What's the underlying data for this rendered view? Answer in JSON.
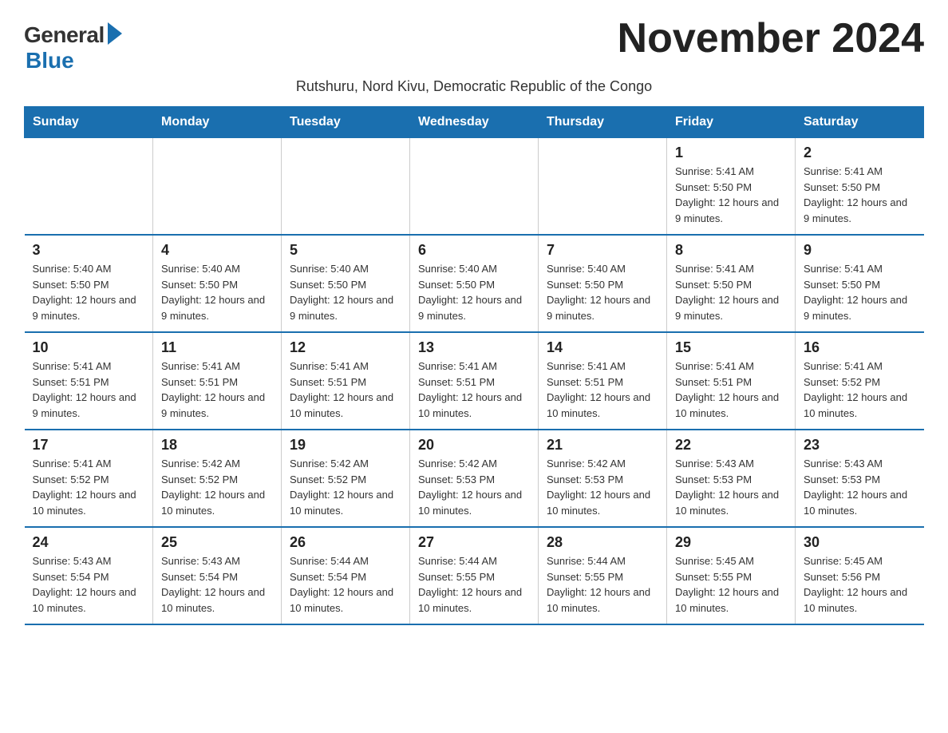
{
  "logo": {
    "general": "General",
    "blue": "Blue"
  },
  "title": "November 2024",
  "subtitle": "Rutshuru, Nord Kivu, Democratic Republic of the Congo",
  "days_of_week": [
    "Sunday",
    "Monday",
    "Tuesday",
    "Wednesday",
    "Thursday",
    "Friday",
    "Saturday"
  ],
  "weeks": [
    [
      {
        "day": "",
        "info": ""
      },
      {
        "day": "",
        "info": ""
      },
      {
        "day": "",
        "info": ""
      },
      {
        "day": "",
        "info": ""
      },
      {
        "day": "",
        "info": ""
      },
      {
        "day": "1",
        "info": "Sunrise: 5:41 AM\nSunset: 5:50 PM\nDaylight: 12 hours\nand 9 minutes."
      },
      {
        "day": "2",
        "info": "Sunrise: 5:41 AM\nSunset: 5:50 PM\nDaylight: 12 hours\nand 9 minutes."
      }
    ],
    [
      {
        "day": "3",
        "info": "Sunrise: 5:40 AM\nSunset: 5:50 PM\nDaylight: 12 hours\nand 9 minutes."
      },
      {
        "day": "4",
        "info": "Sunrise: 5:40 AM\nSunset: 5:50 PM\nDaylight: 12 hours\nand 9 minutes."
      },
      {
        "day": "5",
        "info": "Sunrise: 5:40 AM\nSunset: 5:50 PM\nDaylight: 12 hours\nand 9 minutes."
      },
      {
        "day": "6",
        "info": "Sunrise: 5:40 AM\nSunset: 5:50 PM\nDaylight: 12 hours\nand 9 minutes."
      },
      {
        "day": "7",
        "info": "Sunrise: 5:40 AM\nSunset: 5:50 PM\nDaylight: 12 hours\nand 9 minutes."
      },
      {
        "day": "8",
        "info": "Sunrise: 5:41 AM\nSunset: 5:50 PM\nDaylight: 12 hours\nand 9 minutes."
      },
      {
        "day": "9",
        "info": "Sunrise: 5:41 AM\nSunset: 5:50 PM\nDaylight: 12 hours\nand 9 minutes."
      }
    ],
    [
      {
        "day": "10",
        "info": "Sunrise: 5:41 AM\nSunset: 5:51 PM\nDaylight: 12 hours\nand 9 minutes."
      },
      {
        "day": "11",
        "info": "Sunrise: 5:41 AM\nSunset: 5:51 PM\nDaylight: 12 hours\nand 9 minutes."
      },
      {
        "day": "12",
        "info": "Sunrise: 5:41 AM\nSunset: 5:51 PM\nDaylight: 12 hours\nand 10 minutes."
      },
      {
        "day": "13",
        "info": "Sunrise: 5:41 AM\nSunset: 5:51 PM\nDaylight: 12 hours\nand 10 minutes."
      },
      {
        "day": "14",
        "info": "Sunrise: 5:41 AM\nSunset: 5:51 PM\nDaylight: 12 hours\nand 10 minutes."
      },
      {
        "day": "15",
        "info": "Sunrise: 5:41 AM\nSunset: 5:51 PM\nDaylight: 12 hours\nand 10 minutes."
      },
      {
        "day": "16",
        "info": "Sunrise: 5:41 AM\nSunset: 5:52 PM\nDaylight: 12 hours\nand 10 minutes."
      }
    ],
    [
      {
        "day": "17",
        "info": "Sunrise: 5:41 AM\nSunset: 5:52 PM\nDaylight: 12 hours\nand 10 minutes."
      },
      {
        "day": "18",
        "info": "Sunrise: 5:42 AM\nSunset: 5:52 PM\nDaylight: 12 hours\nand 10 minutes."
      },
      {
        "day": "19",
        "info": "Sunrise: 5:42 AM\nSunset: 5:52 PM\nDaylight: 12 hours\nand 10 minutes."
      },
      {
        "day": "20",
        "info": "Sunrise: 5:42 AM\nSunset: 5:53 PM\nDaylight: 12 hours\nand 10 minutes."
      },
      {
        "day": "21",
        "info": "Sunrise: 5:42 AM\nSunset: 5:53 PM\nDaylight: 12 hours\nand 10 minutes."
      },
      {
        "day": "22",
        "info": "Sunrise: 5:43 AM\nSunset: 5:53 PM\nDaylight: 12 hours\nand 10 minutes."
      },
      {
        "day": "23",
        "info": "Sunrise: 5:43 AM\nSunset: 5:53 PM\nDaylight: 12 hours\nand 10 minutes."
      }
    ],
    [
      {
        "day": "24",
        "info": "Sunrise: 5:43 AM\nSunset: 5:54 PM\nDaylight: 12 hours\nand 10 minutes."
      },
      {
        "day": "25",
        "info": "Sunrise: 5:43 AM\nSunset: 5:54 PM\nDaylight: 12 hours\nand 10 minutes."
      },
      {
        "day": "26",
        "info": "Sunrise: 5:44 AM\nSunset: 5:54 PM\nDaylight: 12 hours\nand 10 minutes."
      },
      {
        "day": "27",
        "info": "Sunrise: 5:44 AM\nSunset: 5:55 PM\nDaylight: 12 hours\nand 10 minutes."
      },
      {
        "day": "28",
        "info": "Sunrise: 5:44 AM\nSunset: 5:55 PM\nDaylight: 12 hours\nand 10 minutes."
      },
      {
        "day": "29",
        "info": "Sunrise: 5:45 AM\nSunset: 5:55 PM\nDaylight: 12 hours\nand 10 minutes."
      },
      {
        "day": "30",
        "info": "Sunrise: 5:45 AM\nSunset: 5:56 PM\nDaylight: 12 hours\nand 10 minutes."
      }
    ]
  ]
}
